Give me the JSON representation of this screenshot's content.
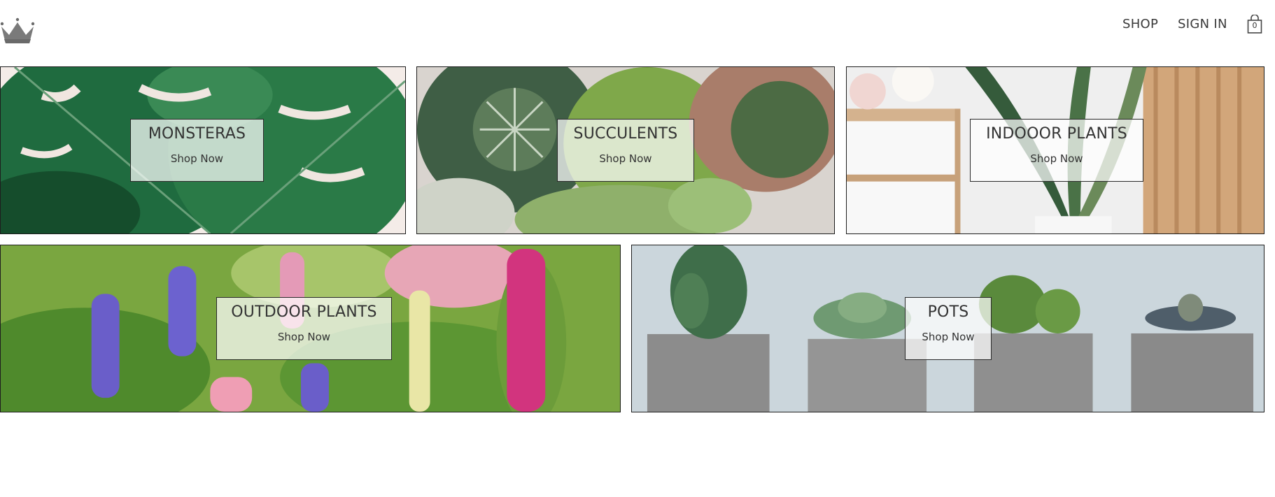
{
  "header": {
    "logo_icon": "crown-icon",
    "nav": {
      "shop_label": "SHOP",
      "signin_label": "SIGN IN"
    },
    "cart": {
      "icon": "shopping-bag-icon",
      "count": "0"
    }
  },
  "categories": [
    {
      "title": "MONSTERAS",
      "cta": "Shop Now"
    },
    {
      "title": "SUCCULENTS",
      "cta": "Shop Now"
    },
    {
      "title": "INDOOOR PLANTS",
      "cta": "Shop Now"
    },
    {
      "title": "OUTDOOR PLANTS",
      "cta": "Shop Now"
    },
    {
      "title": "POTS",
      "cta": "Shop Now"
    }
  ],
  "colors": {
    "text": "#333333",
    "border": "#1e1e1e",
    "background": "#ffffff"
  }
}
